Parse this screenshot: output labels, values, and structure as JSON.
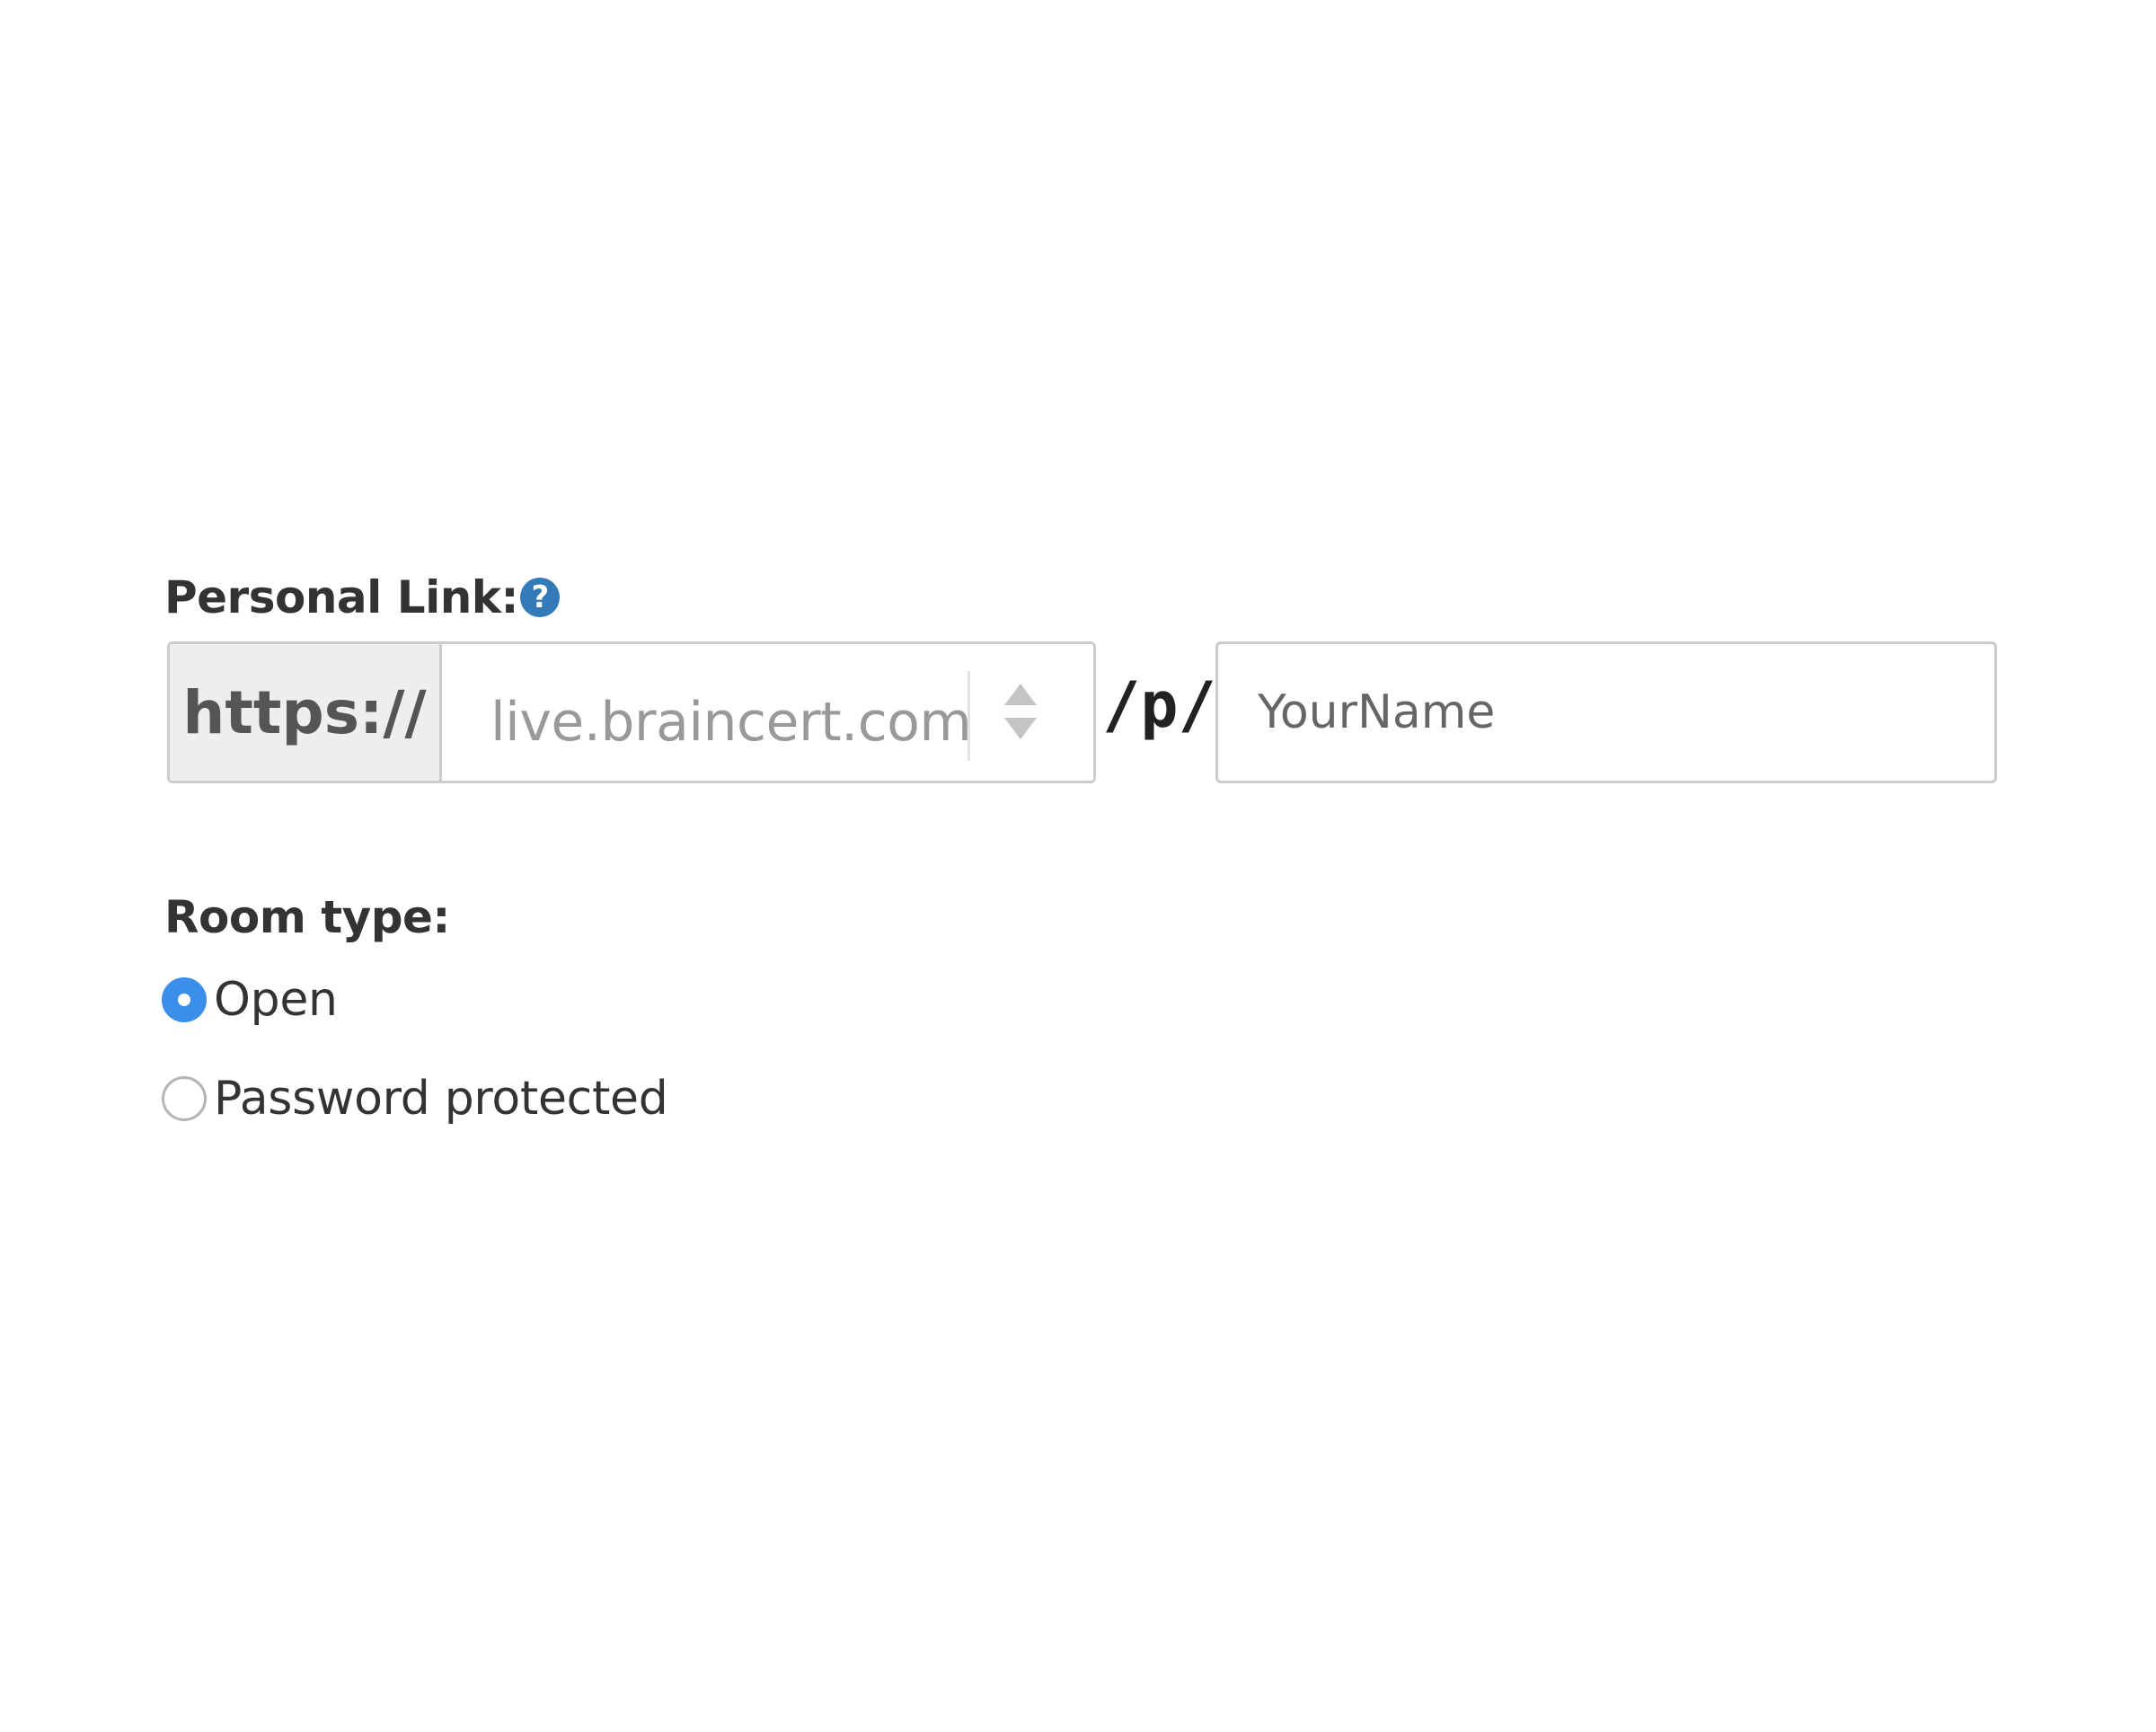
{
  "personal_link": {
    "label": "Personal Link:",
    "help_glyph": "?",
    "help_icon": "question-circle-icon",
    "protocol": "https://",
    "domain_value": "live.braincert.com",
    "domain_arrows_icon": "sort-arrows-icon",
    "path_separator": "/p/",
    "name_placeholder": "YourName"
  },
  "room_type": {
    "label": "Room type:",
    "options": [
      {
        "label": "Open",
        "checked": true
      },
      {
        "label": "Password protected",
        "checked": false
      }
    ]
  },
  "colors": {
    "accent": "#3b8fea",
    "help_icon": "#337ab7",
    "addon_background": "#eeeeee",
    "border": "#cccccc"
  }
}
